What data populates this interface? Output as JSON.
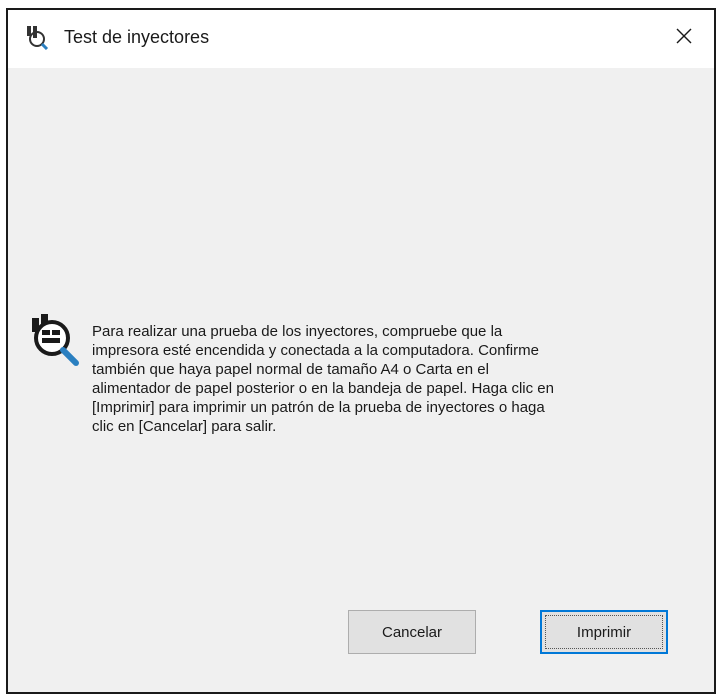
{
  "window": {
    "title": "Test de inyectores",
    "icon": "nozzle-check-icon",
    "close_icon": "close-icon"
  },
  "message": {
    "icon": "nozzle-check-magnifier-icon",
    "text": "Para realizar una prueba de los inyectores, compruebe que la\nimpresora esté encendida y conectada a la computadora. Confirme\ntambién que haya papel normal de tamaño A4 o Carta en el\nalimentador de papel posterior o en la bandeja de papel. Haga clic en\n[Imprimir] para imprimir un patrón de la prueba de inyectores o haga\nclic en [Cancelar] para salir."
  },
  "buttons": {
    "cancel_label": "Cancelar",
    "print_label": "Imprimir"
  },
  "colors": {
    "dialog_bg": "#f0f0f0",
    "titlebar_bg": "#ffffff",
    "default_button_border": "#0078d7"
  }
}
